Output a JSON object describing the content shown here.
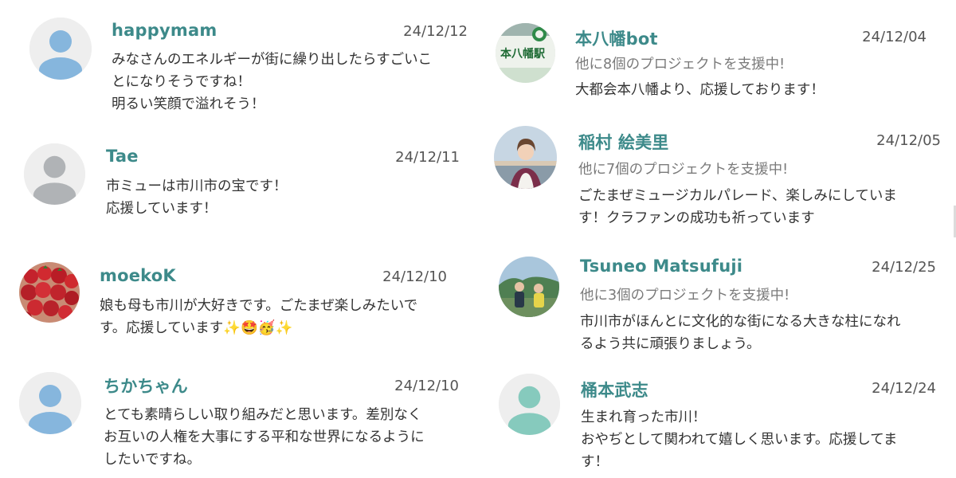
{
  "colors": {
    "name": "#3d8a8a",
    "avatar_bg": "#eeeeee",
    "default_blue": "#86b6dd",
    "default_gray": "#b0b3b6",
    "default_teal": "#86cabd"
  },
  "comments_left": [
    {
      "name": "happymam",
      "date": "24/12/12",
      "avatar": "default-user-blue-icon",
      "body": "みなさんのエネルギーが街に繰り出したらすごいこ\nとになりそうですね！\n明るい笑顔で溢れそう！"
    },
    {
      "name": "Tae",
      "date": "24/12/11",
      "avatar": "default-user-gray-icon",
      "body": "市ミューは市川市の宝です！\n応援しています！"
    },
    {
      "name": "moekoK",
      "date": "24/12/10",
      "avatar": "strawberry-photo",
      "body": "娘も母も市川が大好きです。ごたまぜ楽しみたいで\nす。応援しています✨🤩🥳✨"
    },
    {
      "name": "ちかちゃん",
      "date": "24/12/10",
      "avatar": "default-user-blue-icon",
      "body": "とても素晴らしい取り組みだと思います。差別なく\nお互いの人権を大事にする平和な世界になるように\nしたいですね。"
    }
  ],
  "comments_right": [
    {
      "name": "本八幡bot",
      "date": "24/12/04",
      "avatar": "station-sign-photo",
      "avatar_text": "本八幡駅",
      "supporter": "他に8個のプロジェクトを支援中!",
      "body": "大都会本八幡より、応援しております！"
    },
    {
      "name": "稲村 絵美里",
      "date": "24/12/05",
      "avatar": "person-portrait-photo",
      "supporter": "他に7個のプロジェクトを支援中!",
      "body": "ごたまぜミュージカルパレード、楽しみにしていま\nす！クラファンの成功も祈っています"
    },
    {
      "name": "Tsuneo Matsufuji",
      "date": "24/12/25",
      "avatar": "outdoor-people-photo",
      "supporter": "他に3個のプロジェクトを支援中!",
      "body": "市川市がほんとに文化的な街になる大きな柱になれ\nるよう共に頑張りましょう。"
    },
    {
      "name": "桶本武志",
      "date": "24/12/24",
      "avatar": "default-user-teal-icon",
      "body": "生まれ育った市川！\nおやぢとして関われて嬉しく思います。応援してま\nす！"
    }
  ]
}
